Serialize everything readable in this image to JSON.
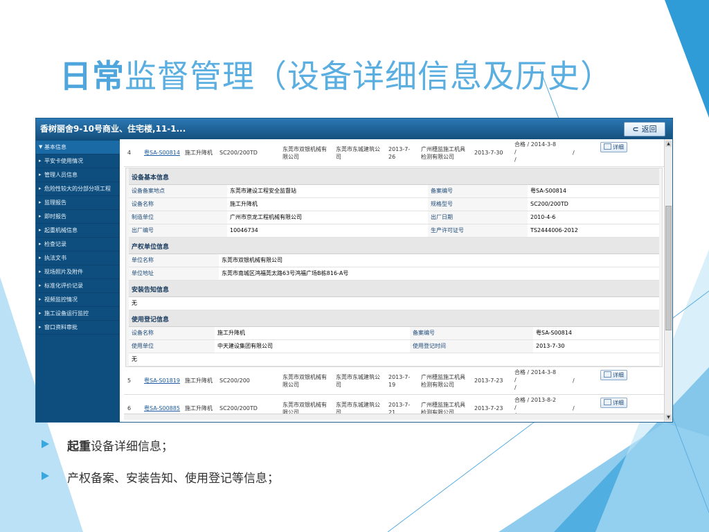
{
  "slide": {
    "title_lead": "日常",
    "title_rest": "监督管理（设备详细信息及历史）",
    "bullets": [
      {
        "lead": "起重",
        "rest": "设备详细信息；"
      },
      {
        "lead": "",
        "rest": "产权备案、安装告知、使用登记等信息；"
      }
    ]
  },
  "app": {
    "title": "香树丽舍9-10号商业、住宅楼,11-1...",
    "back_label": "返回",
    "back_icon": "back-arrow-icon",
    "sidebar": {
      "items": [
        {
          "label": "基本信息",
          "active": true
        },
        {
          "label": "平安卡使用情况"
        },
        {
          "label": "管理人员信息"
        },
        {
          "label": "危险性较大的分部分项工程"
        },
        {
          "label": "监理报告"
        },
        {
          "label": "即时报告"
        },
        {
          "label": "起重机械信息"
        },
        {
          "label": "检查记录"
        },
        {
          "label": "执法文书"
        },
        {
          "label": "现场照片及附件"
        },
        {
          "label": "标准化评价记录"
        },
        {
          "label": "视频监控情况"
        },
        {
          "label": "施工设备运行监控"
        },
        {
          "label": "窗口资料审批"
        }
      ]
    },
    "records": [
      {
        "no": "4",
        "code": "粤SA-S00814",
        "type": "施工升降机",
        "model": "SC200/200TD",
        "manufacturer": "东莞市双银机械有限公司",
        "user": "东莞市东城建筑公司",
        "date1": "2013-7-26",
        "inspector": "广州穗监施工机具检测有限公司",
        "date2": "2013-7-30",
        "result_line1": "合格 / 2014-3-8",
        "result_line2": "/",
        "result_line3": "/",
        "slash": "/",
        "detail_label": "详细"
      },
      {
        "no": "5",
        "code": "粤SA-S01819",
        "type": "施工升降机",
        "model": "SC200/200",
        "manufacturer": "东莞市双银机械有限公司",
        "user": "东莞市东城建筑公司",
        "date1": "2013-7-19",
        "inspector": "广州穗监施工机具检测有限公司",
        "date2": "2013-7-23",
        "result_line1": "合格 / 2014-3-8",
        "result_line2": "/",
        "result_line3": "/",
        "slash": "/",
        "detail_label": "详细"
      },
      {
        "no": "6",
        "code": "粤SA-S00885",
        "type": "施工升降机",
        "model": "SC200/200TD",
        "manufacturer": "东莞市双银机械有限公司",
        "user": "东莞市东城建筑公司",
        "date1": "2013-7-21",
        "inspector": "广州穗监施工机具检测有限公司",
        "date2": "2013-7-23",
        "result_line1": "合格 / 2013-8-2",
        "result_line2": "/",
        "result_line3": "/",
        "slash": "/",
        "detail_label": "详细"
      }
    ],
    "detail": {
      "basic": {
        "heading": "设备基本信息",
        "rows": [
          [
            "设备备案地点",
            "东莞市建设工程安全监督站",
            "备案编号",
            "粤SA-S00814"
          ],
          [
            "设备名称",
            "施工升降机",
            "规格型号",
            "SC200/200TD"
          ],
          [
            "制造单位",
            "广州市京龙工程机械有限公司",
            "出厂日期",
            "2010-4-6"
          ],
          [
            "出厂编号",
            "10046734",
            "生产许可证号",
            "TS2444006-2012"
          ]
        ]
      },
      "owner": {
        "heading": "产权单位信息",
        "rows": [
          [
            "单位名称",
            "东莞市双银机械有限公司"
          ],
          [
            "单位地址",
            "东莞市南城区鸿福莞太路63号鸿福广场B栋816-A号"
          ]
        ]
      },
      "install": {
        "heading": "安装告知信息",
        "value": "无"
      },
      "usage": {
        "heading": "使用登记信息",
        "rows": [
          [
            "设备名称",
            "施工升降机",
            "备案编号",
            "粤SA-S00814"
          ],
          [
            "使用单位",
            "中天建设集团有限公司",
            "使用登记时间",
            "2013-7-30"
          ]
        ],
        "value": "无"
      }
    }
  },
  "colors": {
    "title": "#5aaee0",
    "header": "#1f6aa5",
    "sidebar": "#0e4e7e",
    "accent": "#3ba7e0"
  }
}
